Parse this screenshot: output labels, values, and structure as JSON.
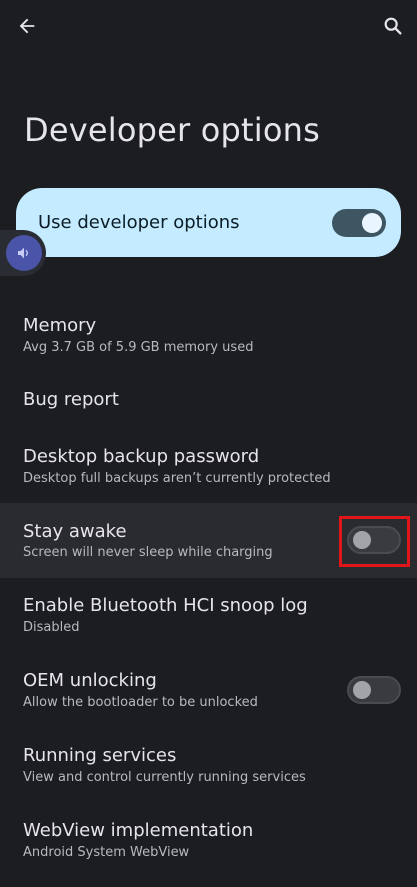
{
  "page": {
    "title": "Developer options"
  },
  "master_switch": {
    "label": "Use developer options",
    "state": "on"
  },
  "items": [
    {
      "title": "Memory",
      "subtitle": "Avg 3.7 GB of 5.9 GB memory used"
    },
    {
      "title": "Bug report",
      "subtitle": ""
    },
    {
      "title": "Desktop backup password",
      "subtitle": "Desktop full backups aren’t currently protected"
    },
    {
      "title": "Stay awake",
      "subtitle": "Screen will never sleep while charging",
      "toggle": "off",
      "highlighted": true
    },
    {
      "title": "Enable Bluetooth HCI snoop log",
      "subtitle": "Disabled"
    },
    {
      "title": "OEM unlocking",
      "subtitle": "Allow the bootloader to be unlocked",
      "toggle": "off"
    },
    {
      "title": "Running services",
      "subtitle": "View and control currently running services"
    },
    {
      "title": "WebView implementation",
      "subtitle": "Android System WebView"
    }
  ],
  "icons": {
    "back": "arrow-back-icon",
    "search": "search-icon",
    "volume": "volume-icon"
  },
  "colors": {
    "background": "#1c1d20",
    "master_card": "#c4ebff",
    "highlight_row": "#2a2b2e",
    "annotation": "#e0161b"
  }
}
